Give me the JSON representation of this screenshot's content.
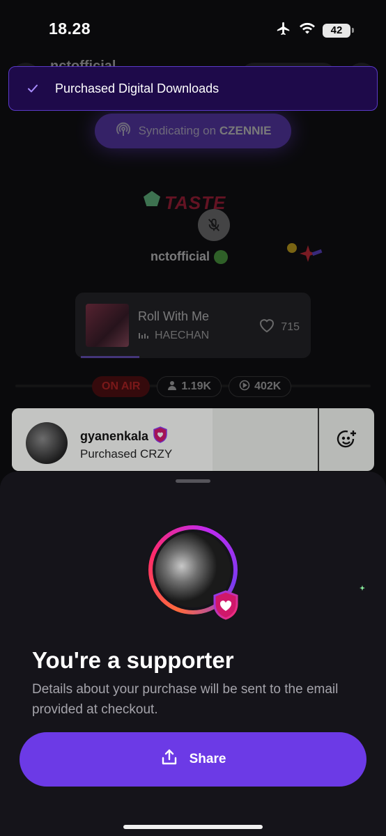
{
  "status_bar": {
    "time": "18.28",
    "battery": "42",
    "icons": [
      "airplane-icon",
      "wifi-icon",
      "battery-icon"
    ]
  },
  "toast": {
    "message": "Purchased Digital Downloads",
    "icon": "checkmark-icon"
  },
  "live": {
    "host_ghost": "nctofficial",
    "syndicate_prefix": "Syndicating on ",
    "syndicate_name": "CZENNIE",
    "logo_text": "TASTE",
    "host_name": "nctofficial",
    "track": {
      "title": "Roll With Me",
      "artist": "HAECHAN",
      "likes": "715"
    },
    "status": {
      "on_air": "ON AIR",
      "listeners": "1.19K",
      "plays": "402K"
    },
    "activity": {
      "user": "gyanenkala",
      "action": "Purchased CRZY"
    }
  },
  "sheet": {
    "title": "You're a supporter",
    "description": "Details about your purchase will be sent to the email provided at checkout.",
    "share_label": "Share"
  },
  "colors": {
    "accent": "#6c3ae6",
    "toast_bg": "#1e0a4a",
    "on_air": "#ff2a2a",
    "sheet_bg": "#15141a"
  }
}
